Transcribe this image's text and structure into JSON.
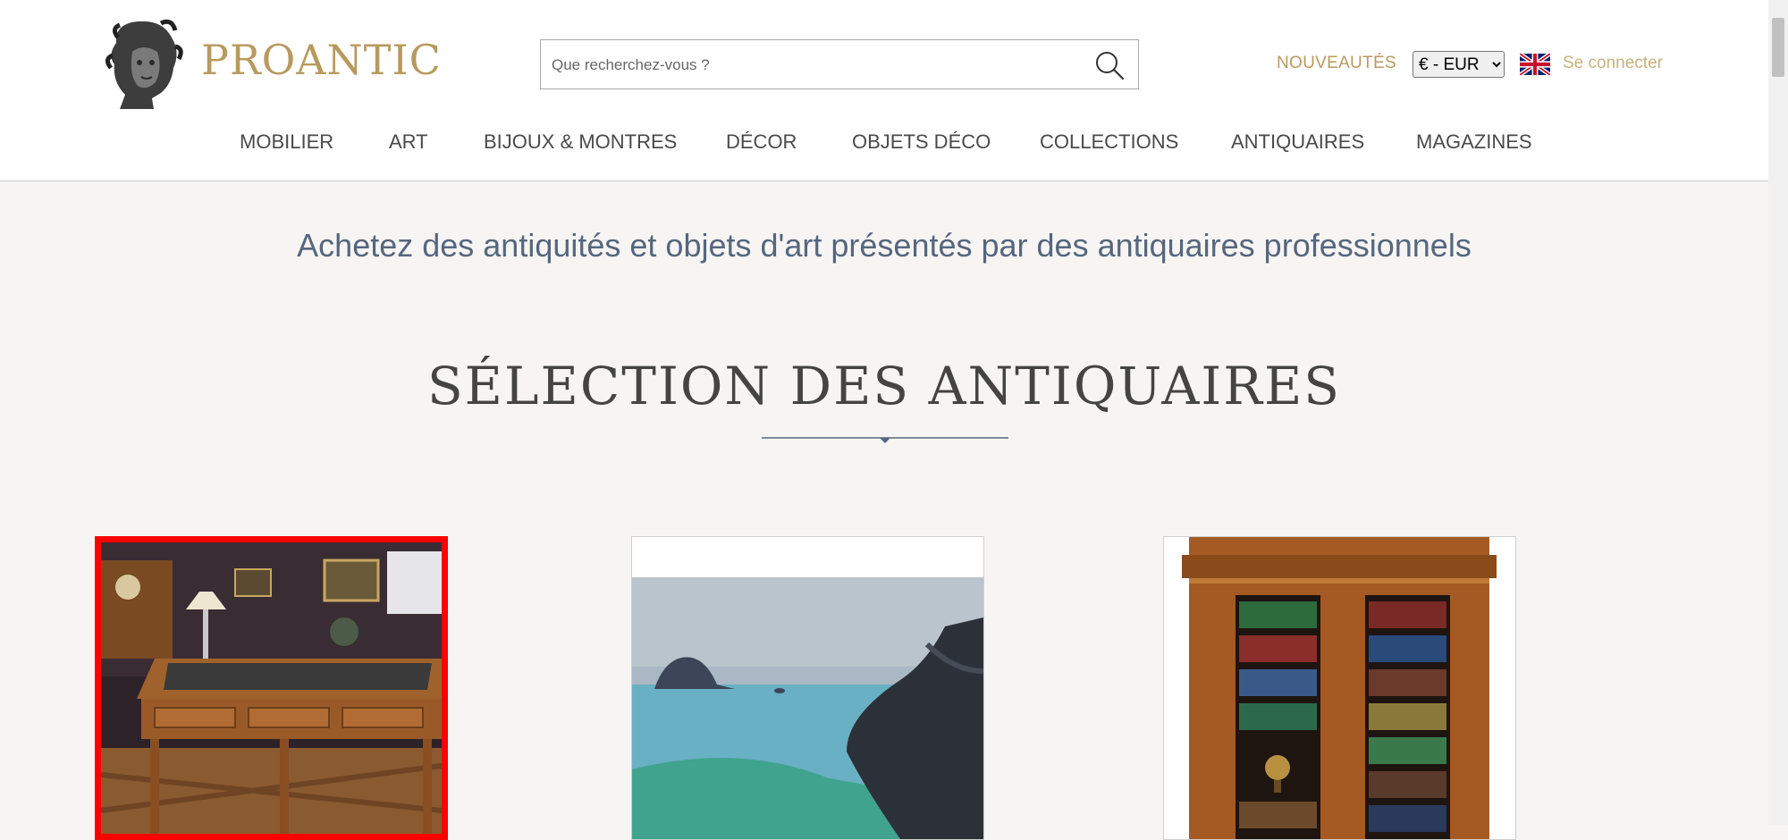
{
  "header": {
    "logo_text": "PROANTIC",
    "search": {
      "placeholder": "Que recherchez-vous ?",
      "value": ""
    },
    "nouveautes_label": "NOUVEAUTÉS",
    "currency": {
      "selected": "€ - EUR",
      "options": [
        "€ - EUR"
      ]
    },
    "language_flag": "uk-flag-icon",
    "login_label": "Se connecter"
  },
  "nav": {
    "items": [
      {
        "label": "MOBILIER"
      },
      {
        "label": "ART"
      },
      {
        "label": "BIJOUX & MONTRES"
      },
      {
        "label": "DÉCOR"
      },
      {
        "label": "OBJETS DÉCO"
      },
      {
        "label": "COLLECTIONS"
      },
      {
        "label": "ANTIQUAIRES"
      },
      {
        "label": "MAGAZINES"
      }
    ]
  },
  "main": {
    "tagline": "Achetez des antiquités et objets d'art présentés par des antiquaires professionnels",
    "section_title": "SÉLECTION DES ANTIQUAIRES",
    "products": [
      {
        "image": "writing-desk-photo"
      },
      {
        "image": "seascape-painting-photo"
      },
      {
        "image": "bookcase-photo"
      }
    ]
  },
  "colors": {
    "brand_gold": "#b89a5e",
    "tagline_blue": "#56667e",
    "page_background": "#f6f5f3",
    "selected_outline": "#ff0000"
  }
}
